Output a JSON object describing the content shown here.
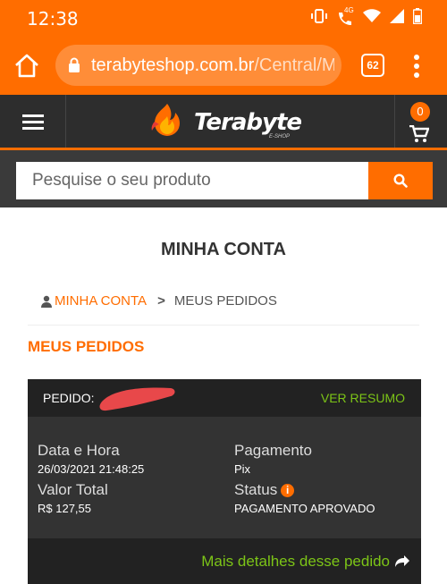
{
  "status_bar": {
    "time": "12:38",
    "icons": [
      "vibrate-icon",
      "call-4g-icon",
      "wifi-icon",
      "signal-icon",
      "battery-icon"
    ],
    "network_label": "4G"
  },
  "browser": {
    "url_host": "terabyteshop.com.br",
    "url_path": "/Central/M",
    "tab_count": "62"
  },
  "site": {
    "logo_text": "Terabyte",
    "logo_sub": "E-SHOP",
    "cart_count": "0"
  },
  "search": {
    "placeholder": "Pesquise o seu produto"
  },
  "page": {
    "title": "MINHA CONTA",
    "breadcrumb": {
      "link": "MINHA CONTA",
      "current": "MEUS PEDIDOS"
    },
    "section_title": "MEUS PEDIDOS"
  },
  "order": {
    "label": "PEDIDO:",
    "view_summary": "VER RESUMO",
    "date_label": "Data e Hora",
    "date_value": "26/03/2021 21:48:25",
    "payment_label": "Pagamento",
    "payment_value": "Pix",
    "total_label": "Valor Total",
    "total_value": "R$ 127,55",
    "status_label": "Status",
    "status_value": "PAGAMENTO APROVADO",
    "more_details": "Mais detalhes desse pedido"
  },
  "colors": {
    "brand_orange": "#ff6d00",
    "link_green": "#7cc417",
    "dark_header": "#2d2d2d",
    "redaction_red": "#e8484a"
  }
}
